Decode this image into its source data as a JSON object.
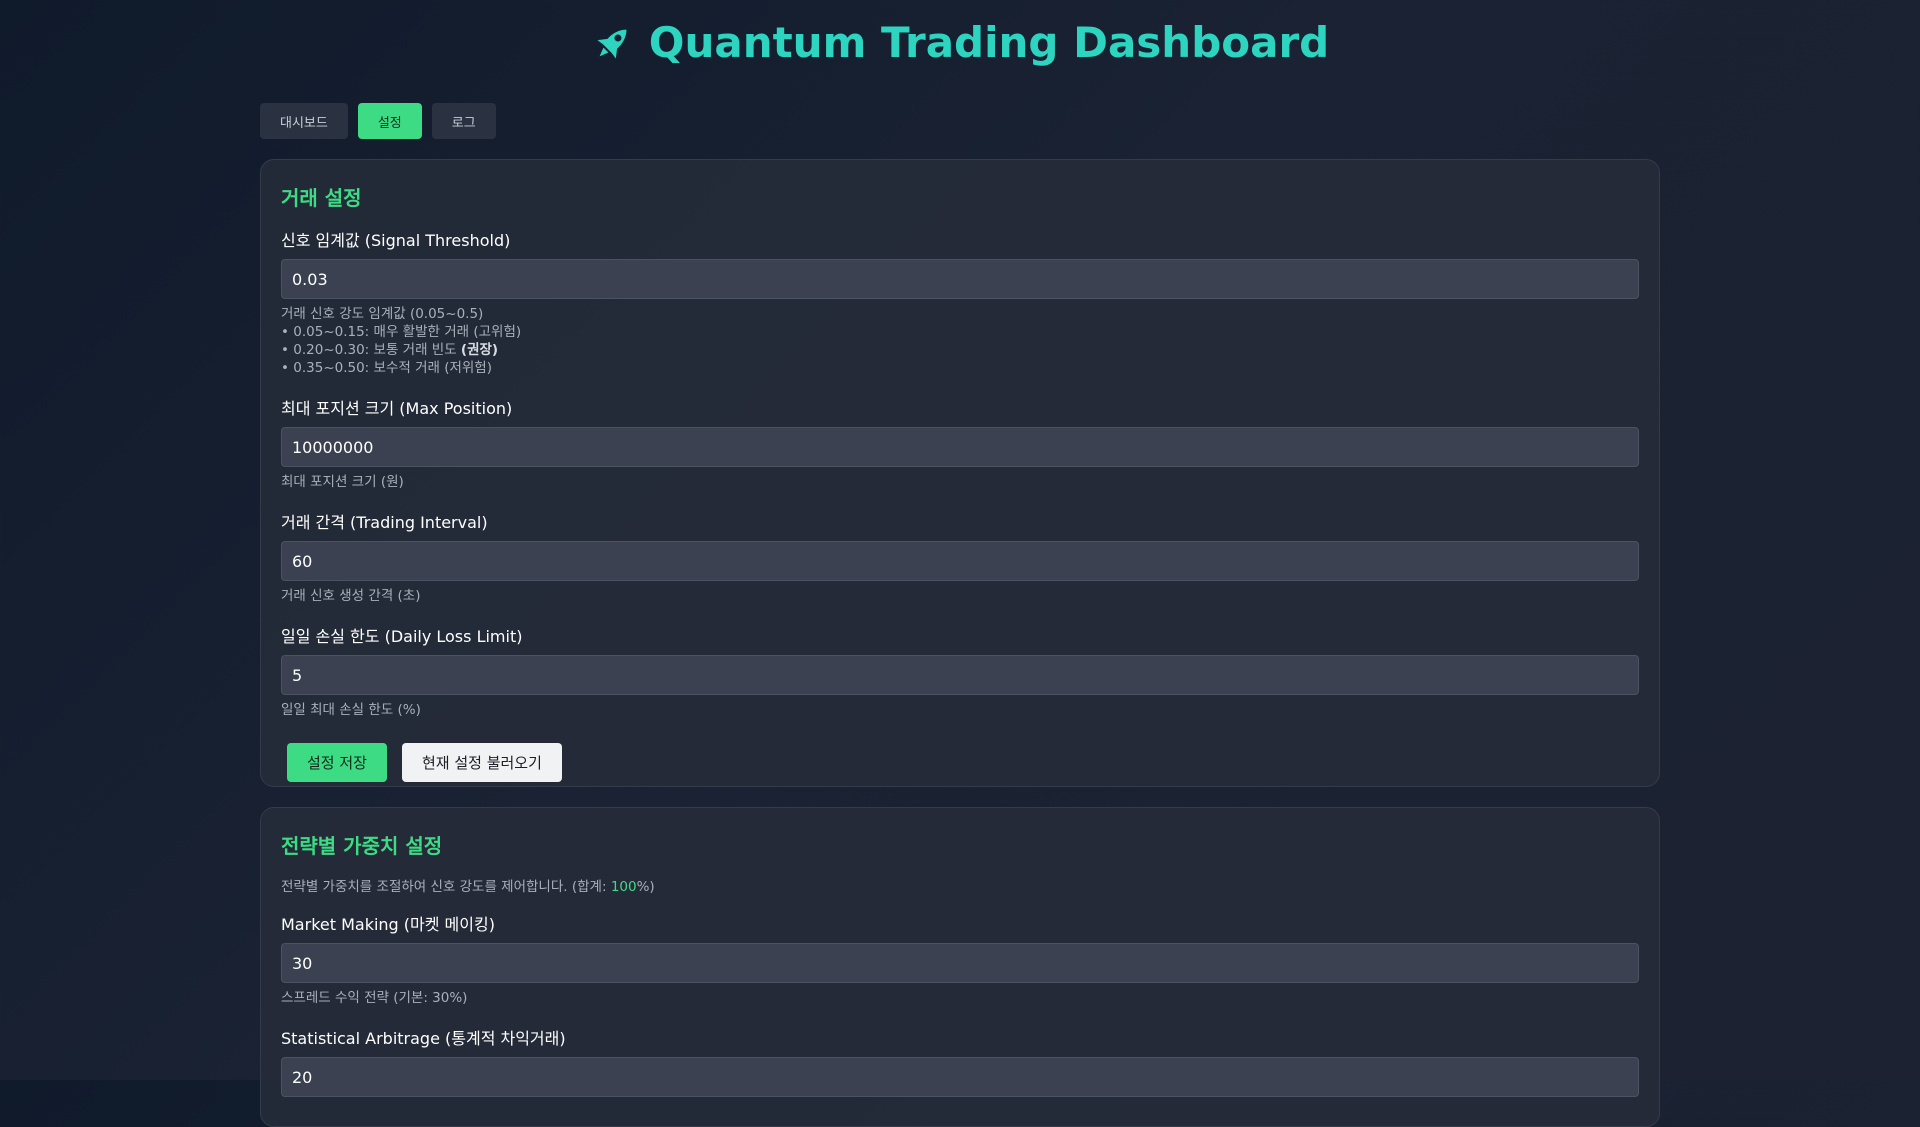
{
  "header": {
    "title": "Quantum Trading Dashboard",
    "icon": "rocket-icon",
    "accent": "#2dd4bf"
  },
  "tabs": [
    {
      "label": "대시보드",
      "active": false
    },
    {
      "label": "설정",
      "active": true
    },
    {
      "label": "로그",
      "active": false
    }
  ],
  "trading": {
    "title": "거래 설정",
    "signal": {
      "label": "신호 임계값 (Signal Threshold)",
      "value": "0.03",
      "help": [
        "거래 신호 강도 임계값 (0.05~0.5)",
        "• 0.05~0.15: 매우 활발한 거래 (고위험)",
        "• 0.20~0.30: 보통 거래 빈도 ",
        "(권장)",
        "• 0.35~0.50: 보수적 거래 (저위험)"
      ]
    },
    "max_position": {
      "label": "최대 포지션 크기 (Max Position)",
      "value": "10000000",
      "help": "최대 포지션 크기 (원)"
    },
    "interval": {
      "label": "거래 간격 (Trading Interval)",
      "value": "60",
      "help": "거래 신호 생성 간격 (초)"
    },
    "daily_loss": {
      "label": "일일 손실 한도 (Daily Loss Limit)",
      "value": "5",
      "help": "일일 최대 손실 한도 (%)"
    },
    "save_label": "설정 저장",
    "load_label": "현재 설정 불러오기"
  },
  "weights": {
    "title": "전략별 가중치 설정",
    "desc_prefix": "전략별 가중치를 조절하여 신호 강도를 제어합니다. (합계: ",
    "desc_total": "100",
    "desc_suffix": "%)",
    "market_making": {
      "label": "Market Making (마켓 메이킹)",
      "value": "30",
      "help": "스프레드 수익 전략 (기본: 30%)"
    },
    "stat_arb": {
      "label": "Statistical Arbitrage (통계적 차익거래)",
      "value": "20"
    }
  },
  "colors": {
    "accent_green": "#3ddc84",
    "teal": "#2dd4bf"
  }
}
